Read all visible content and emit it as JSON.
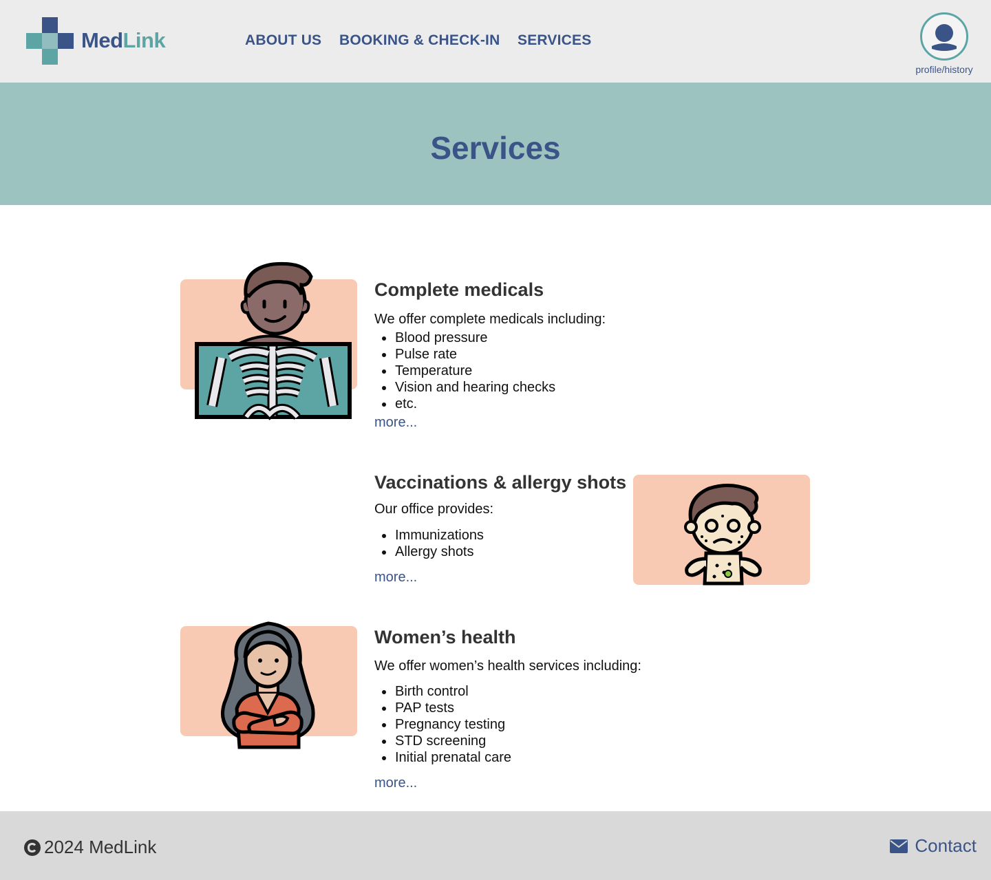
{
  "brand": {
    "name_part1": "Med",
    "name_part2": "Link",
    "color_primary": "#3b5488",
    "color_accent": "#5ca5a4"
  },
  "nav": {
    "items": [
      {
        "label": "ABOUT US"
      },
      {
        "label": "BOOKING & CHECK-IN"
      },
      {
        "label": "SERVICES"
      }
    ]
  },
  "profile": {
    "label": "profile/history",
    "icon": "user-avatar-icon"
  },
  "banner": {
    "title": "Services",
    "bg": "#9cc3bf"
  },
  "services": [
    {
      "title": "Complete medicals",
      "intro": "We offer complete medicals including:",
      "items": [
        "Blood pressure",
        "Pulse rate",
        "Temperature",
        "Vision and hearing checks",
        "etc."
      ],
      "more": "more...",
      "illustration": "xray-icon"
    },
    {
      "title": "Vaccinations & allergy shots",
      "intro": "Our office provides:",
      "items": [
        "Immunizations",
        "Allergy shots"
      ],
      "more": "more...",
      "illustration": "allergy-child-icon"
    },
    {
      "title": "Women’s health",
      "intro": "We offer women’s health services including:",
      "items": [
        "Birth control",
        "PAP tests",
        "Pregnancy testing",
        "STD screening",
        "Initial prenatal care"
      ],
      "more": "more...",
      "illustration": "woman-icon"
    }
  ],
  "footer": {
    "copyright": "2024 MedLink",
    "contact": "Contact",
    "copyright_icon": "copyright-icon",
    "contact_icon": "envelope-icon"
  }
}
